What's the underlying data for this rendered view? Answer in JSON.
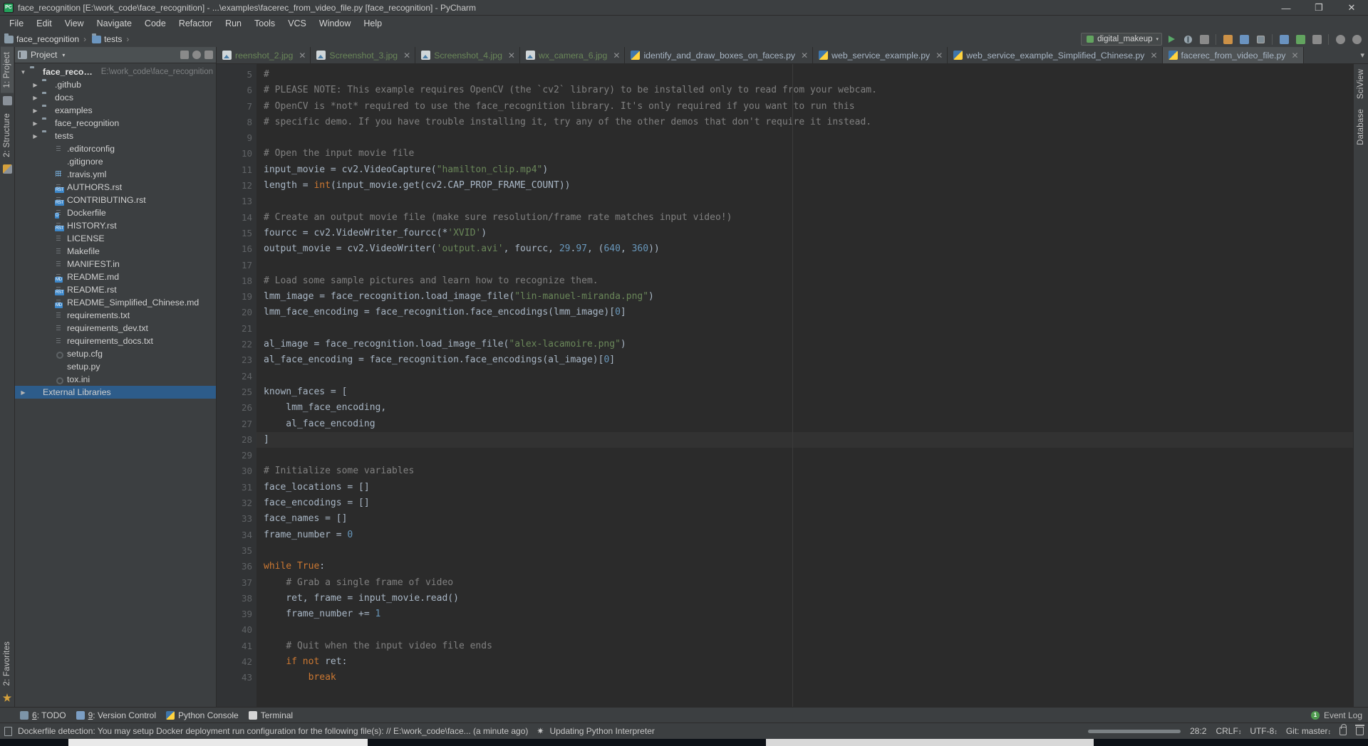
{
  "window": {
    "title": "face_recognition [E:\\work_code\\face_recognition] - ...\\examples\\facerec_from_video_file.py [face_recognition] - PyCharm",
    "logo_text": "PC",
    "minimize": "—",
    "maximize": "❐",
    "close": "✕"
  },
  "menubar": {
    "items": [
      "File",
      "Edit",
      "View",
      "Navigate",
      "Code",
      "Refactor",
      "Run",
      "Tools",
      "VCS",
      "Window",
      "Help"
    ]
  },
  "breadcrumb": {
    "items": [
      "face_recognition",
      "tests"
    ],
    "separator": "›"
  },
  "toolbar": {
    "run_config": "digital_makeup",
    "run_config_caret": "▾",
    "icons": [
      "run-icon",
      "debug-icon",
      "coverage-icon",
      "profile-icon",
      "attach-icon",
      "stop-icon",
      "search-everywhere-icon",
      "vcs-update-icon",
      "vcs-commit-icon",
      "vcs-history-icon",
      "undo-icon",
      "redo-icon",
      "settings-icon",
      "search-icon"
    ]
  },
  "left_strip": {
    "tabs": [
      "1: Project",
      "2: Structure"
    ],
    "bottom_tabs": [
      "2: Favorites"
    ]
  },
  "project_panel": {
    "title": "Project",
    "title_caret": "▾",
    "collapse_icon": "collapse-all-icon",
    "settings_icon": "gear-icon",
    "hide_icon": "hide-icon",
    "tree": [
      {
        "label": "face_recognition",
        "path": "E:\\work_code\\face_recognition",
        "indent": 0,
        "arrow": "▼",
        "icon": "folder-root",
        "bold": true,
        "selected": false
      },
      {
        "label": ".github",
        "path": "",
        "indent": 1,
        "arrow": "▶",
        "icon": "folder",
        "bold": false,
        "selected": false
      },
      {
        "label": "docs",
        "path": "",
        "indent": 1,
        "arrow": "▶",
        "icon": "folder-src",
        "bold": false,
        "selected": false
      },
      {
        "label": "examples",
        "path": "",
        "indent": 1,
        "arrow": "▶",
        "icon": "folder-src",
        "bold": false,
        "selected": false
      },
      {
        "label": "face_recognition",
        "path": "",
        "indent": 1,
        "arrow": "▶",
        "icon": "folder-src",
        "bold": false,
        "selected": false
      },
      {
        "label": "tests",
        "path": "",
        "indent": 1,
        "arrow": "▶",
        "icon": "folder-src",
        "bold": false,
        "selected": false
      },
      {
        "label": ".editorconfig",
        "path": "",
        "indent": 2,
        "arrow": "",
        "icon": "file-text",
        "bold": false,
        "selected": false
      },
      {
        "label": ".gitignore",
        "path": "",
        "indent": 2,
        "arrow": "",
        "icon": "file-git",
        "bold": false,
        "selected": false
      },
      {
        "label": ".travis.yml",
        "path": "",
        "indent": 2,
        "arrow": "",
        "icon": "file-yml",
        "bold": false,
        "selected": false
      },
      {
        "label": "AUTHORS.rst",
        "path": "",
        "indent": 2,
        "arrow": "",
        "icon": "file-rst",
        "bold": false,
        "selected": false
      },
      {
        "label": "CONTRIBUTING.rst",
        "path": "",
        "indent": 2,
        "arrow": "",
        "icon": "file-rst",
        "bold": false,
        "selected": false
      },
      {
        "label": "Dockerfile",
        "path": "",
        "indent": 2,
        "arrow": "",
        "icon": "file-docker",
        "bold": false,
        "selected": false
      },
      {
        "label": "HISTORY.rst",
        "path": "",
        "indent": 2,
        "arrow": "",
        "icon": "file-rst",
        "bold": false,
        "selected": false
      },
      {
        "label": "LICENSE",
        "path": "",
        "indent": 2,
        "arrow": "",
        "icon": "file-text",
        "bold": false,
        "selected": false
      },
      {
        "label": "Makefile",
        "path": "",
        "indent": 2,
        "arrow": "",
        "icon": "file-text",
        "bold": false,
        "selected": false
      },
      {
        "label": "MANIFEST.in",
        "path": "",
        "indent": 2,
        "arrow": "",
        "icon": "file-text",
        "bold": false,
        "selected": false
      },
      {
        "label": "README.md",
        "path": "",
        "indent": 2,
        "arrow": "",
        "icon": "file-md",
        "bold": false,
        "selected": false
      },
      {
        "label": "README.rst",
        "path": "",
        "indent": 2,
        "arrow": "",
        "icon": "file-rst",
        "bold": false,
        "selected": false
      },
      {
        "label": "README_Simplified_Chinese.md",
        "path": "",
        "indent": 2,
        "arrow": "",
        "icon": "file-md",
        "bold": false,
        "selected": false
      },
      {
        "label": "requirements.txt",
        "path": "",
        "indent": 2,
        "arrow": "",
        "icon": "file-text",
        "bold": false,
        "selected": false
      },
      {
        "label": "requirements_dev.txt",
        "path": "",
        "indent": 2,
        "arrow": "",
        "icon": "file-text",
        "bold": false,
        "selected": false
      },
      {
        "label": "requirements_docs.txt",
        "path": "",
        "indent": 2,
        "arrow": "",
        "icon": "file-text",
        "bold": false,
        "selected": false
      },
      {
        "label": "setup.cfg",
        "path": "",
        "indent": 2,
        "arrow": "",
        "icon": "file-cfg",
        "bold": false,
        "selected": false
      },
      {
        "label": "setup.py",
        "path": "",
        "indent": 2,
        "arrow": "",
        "icon": "file-py",
        "bold": false,
        "selected": false
      },
      {
        "label": "tox.ini",
        "path": "",
        "indent": 2,
        "arrow": "",
        "icon": "file-cfg",
        "bold": false,
        "selected": false
      },
      {
        "label": "External Libraries",
        "path": "",
        "indent": 0,
        "arrow": "▶",
        "icon": "library",
        "bold": false,
        "selected": true
      }
    ]
  },
  "editor_tabs": [
    {
      "label": "reenshot_2.jpg",
      "icon": "image-file-icon",
      "color": "green",
      "active": false,
      "close": "✕"
    },
    {
      "label": "Screenshot_3.jpg",
      "icon": "image-file-icon",
      "color": "green",
      "active": false,
      "close": "✕"
    },
    {
      "label": "Screenshot_4.jpg",
      "icon": "image-file-icon",
      "color": "green",
      "active": false,
      "close": "✕"
    },
    {
      "label": "wx_camera_6.jpg",
      "icon": "image-file-icon",
      "color": "green",
      "active": false,
      "close": "✕"
    },
    {
      "label": "identify_and_draw_boxes_on_faces.py",
      "icon": "python-file-icon",
      "color": "blue",
      "active": false,
      "close": "✕"
    },
    {
      "label": "web_service_example.py",
      "icon": "python-file-icon",
      "color": "blue",
      "active": false,
      "close": "✕"
    },
    {
      "label": "web_service_example_Simplified_Chinese.py",
      "icon": "python-file-icon",
      "color": "blue",
      "active": false,
      "close": "✕"
    },
    {
      "label": "facerec_from_video_file.py",
      "icon": "python-file-icon",
      "color": "blue",
      "active": true,
      "close": "✕"
    }
  ],
  "editor": {
    "first_line_number": 5,
    "lines": [
      {
        "n": 5,
        "fold": "",
        "text": "#"
      },
      {
        "n": 6,
        "fold": "",
        "text": "# PLEASE NOTE: This example requires OpenCV (the `cv2` library) to be installed only to read from your webcam."
      },
      {
        "n": 7,
        "fold": "",
        "text": "# OpenCV is *not* required to use the face_recognition library. It's only required if you want to run this"
      },
      {
        "n": 8,
        "fold": "",
        "text": "# specific demo. If you have trouble installing it, try any of the other demos that don't require it instead."
      },
      {
        "n": 9,
        "fold": "",
        "text": ""
      },
      {
        "n": 10,
        "fold": "start",
        "text": "# Open the input movie file"
      },
      {
        "n": 11,
        "fold": "",
        "text": "input_movie = cv2.VideoCapture(\"hamilton_clip.mp4\")"
      },
      {
        "n": 12,
        "fold": "",
        "text": "length = int(input_movie.get(cv2.CAP_PROP_FRAME_COUNT))"
      },
      {
        "n": 13,
        "fold": "",
        "text": ""
      },
      {
        "n": 14,
        "fold": "",
        "text": "# Create an output movie file (make sure resolution/frame rate matches input video!)"
      },
      {
        "n": 15,
        "fold": "",
        "text": "fourcc = cv2.VideoWriter_fourcc(*'XVID')"
      },
      {
        "n": 16,
        "fold": "",
        "text": "output_movie = cv2.VideoWriter('output.avi', fourcc, 29.97, (640, 360))"
      },
      {
        "n": 17,
        "fold": "",
        "text": ""
      },
      {
        "n": 18,
        "fold": "",
        "text": "# Load some sample pictures and learn how to recognize them."
      },
      {
        "n": 19,
        "fold": "",
        "text": "lmm_image = face_recognition.load_image_file(\"lin-manuel-miranda.png\")"
      },
      {
        "n": 20,
        "fold": "",
        "text": "lmm_face_encoding = face_recognition.face_encodings(lmm_image)[0]"
      },
      {
        "n": 21,
        "fold": "",
        "text": ""
      },
      {
        "n": 22,
        "fold": "",
        "text": "al_image = face_recognition.load_image_file(\"alex-lacamoire.png\")"
      },
      {
        "n": 23,
        "fold": "",
        "text": "al_face_encoding = face_recognition.face_encodings(al_image)[0]"
      },
      {
        "n": 24,
        "fold": "",
        "text": ""
      },
      {
        "n": 25,
        "fold": "start",
        "text": "known_faces = ["
      },
      {
        "n": 26,
        "fold": "",
        "text": "    lmm_face_encoding,"
      },
      {
        "n": 27,
        "fold": "",
        "text": "    al_face_encoding"
      },
      {
        "n": 28,
        "fold": "end",
        "text": "]"
      },
      {
        "n": 29,
        "fold": "",
        "text": ""
      },
      {
        "n": 30,
        "fold": "",
        "text": "# Initialize some variables"
      },
      {
        "n": 31,
        "fold": "",
        "text": "face_locations = []"
      },
      {
        "n": 32,
        "fold": "",
        "text": "face_encodings = []"
      },
      {
        "n": 33,
        "fold": "",
        "text": "face_names = []"
      },
      {
        "n": 34,
        "fold": "",
        "text": "frame_number = 0"
      },
      {
        "n": 35,
        "fold": "",
        "text": ""
      },
      {
        "n": 36,
        "fold": "start",
        "text": "while True:"
      },
      {
        "n": 37,
        "fold": "",
        "text": "    # Grab a single frame of video"
      },
      {
        "n": 38,
        "fold": "",
        "text": "    ret, frame = input_movie.read()"
      },
      {
        "n": 39,
        "fold": "",
        "text": "    frame_number += 1"
      },
      {
        "n": 40,
        "fold": "",
        "text": ""
      },
      {
        "n": 41,
        "fold": "",
        "text": "    # Quit when the input video file ends"
      },
      {
        "n": 42,
        "fold": "",
        "text": "    if not ret:"
      },
      {
        "n": 43,
        "fold": "",
        "text": "        break"
      }
    ],
    "highlighted_line": 28
  },
  "right_strip": {
    "tabs": [
      "SciView",
      "Database"
    ]
  },
  "bottom_tool_windows": {
    "items": [
      {
        "num": "6",
        "label": "TODO",
        "icon": "todo-icon"
      },
      {
        "num": "9",
        "label": "Version Control",
        "icon": "vcs-icon"
      },
      {
        "num": "",
        "label": "Python Console",
        "icon": "python-console-icon"
      },
      {
        "num": "",
        "label": "Terminal",
        "icon": "terminal-icon"
      }
    ],
    "event_log": {
      "label": "Event Log",
      "badge": "1"
    }
  },
  "statusbar": {
    "message": "Dockerfile detection: You may setup Docker deployment run configuration for the following file(s): // E:\\work_code\\face... (a minute ago)",
    "background_task": "Updating Python Interpreter",
    "caret_position": "28:2",
    "line_separator": "CRLF",
    "encoding": "UTF-8",
    "branch": "Git: master",
    "updown": "↕",
    "lock_icon": "lock-icon",
    "trash_icon": "trash-icon"
  },
  "colors": {
    "background": "#3c3f41",
    "editor_background": "#2b2b2b",
    "gutter_background": "#313335",
    "accent_selection": "#2d5c8a",
    "comment": "#808080",
    "string": "#6a8759",
    "keyword": "#cc7832",
    "number": "#6897bb",
    "text": "#a9b7c6",
    "run_green": "#59a869"
  }
}
